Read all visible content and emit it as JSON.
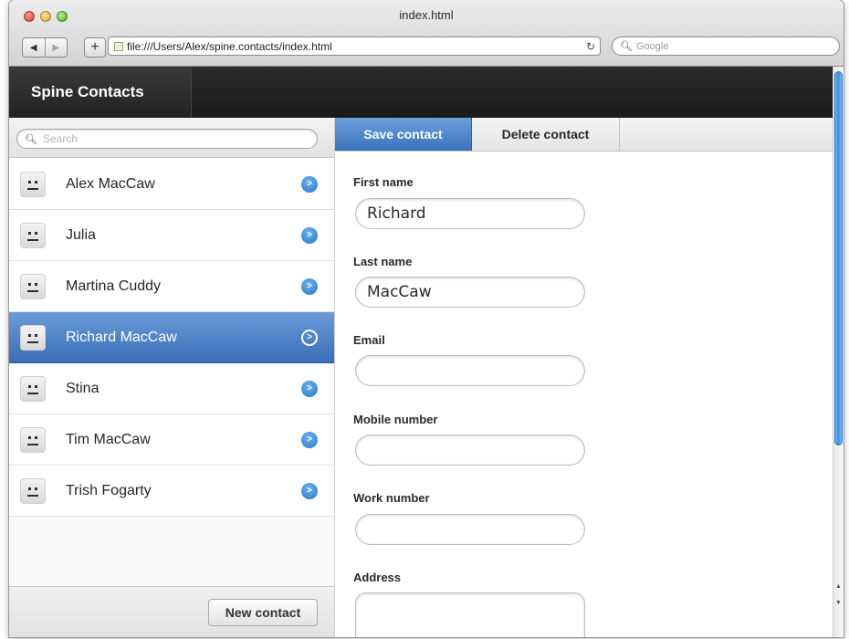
{
  "window": {
    "title": "index.html"
  },
  "browser": {
    "url": "file:///Users/Alex/spine.contacts/index.html",
    "search_placeholder": "Google",
    "back_icon": "◀",
    "forward_icon": "▶",
    "add_icon": "+",
    "reload_icon": "↻"
  },
  "app": {
    "brand": "Spine Contacts"
  },
  "sidebar": {
    "search_placeholder": "Search",
    "contacts": [
      {
        "name": "Alex MacCaw",
        "selected": false
      },
      {
        "name": "Julia",
        "selected": false
      },
      {
        "name": "Martina Cuddy",
        "selected": false
      },
      {
        "name": "Richard MacCaw",
        "selected": true
      },
      {
        "name": "Stina",
        "selected": false
      },
      {
        "name": "Tim MacCaw",
        "selected": false
      },
      {
        "name": "Trish Fogarty",
        "selected": false
      }
    ],
    "new_contact_label": "New contact"
  },
  "toolbar": {
    "save_label": "Save contact",
    "delete_label": "Delete contact"
  },
  "form": {
    "first_name_label": "First name",
    "first_name_value": "Richard",
    "last_name_label": "Last name",
    "last_name_value": "MacCaw",
    "email_label": "Email",
    "email_value": "",
    "mobile_label": "Mobile number",
    "mobile_value": "",
    "work_label": "Work number",
    "work_value": "",
    "address_label": "Address",
    "address_value": ""
  },
  "colors": {
    "accent": "#3b72bc",
    "header_bg": "#1f1f1f",
    "go_icon": "#2277c7"
  }
}
